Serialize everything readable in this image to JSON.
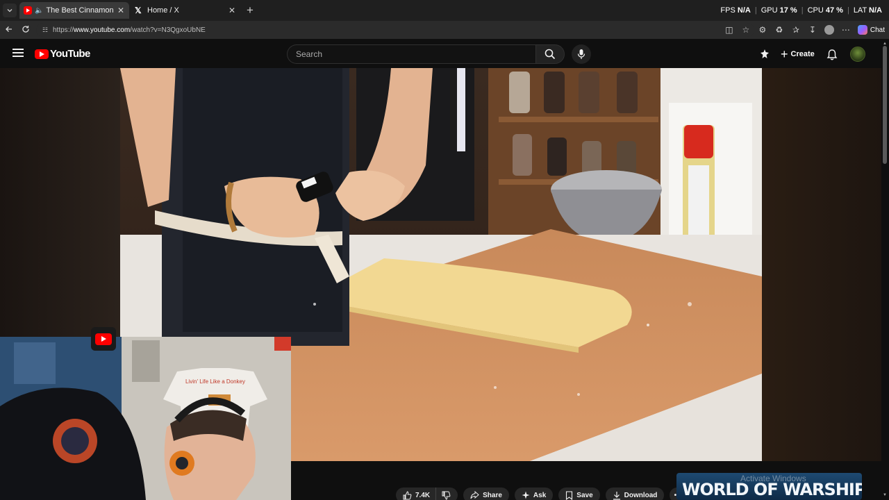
{
  "browser": {
    "tabs": [
      {
        "title": "The Best Cinnamon Buns At H",
        "active": true,
        "audio": true,
        "favicon": "youtube-icon"
      },
      {
        "title": "Home / X",
        "active": false,
        "audio": false,
        "favicon": "x-icon"
      }
    ],
    "stats": {
      "fps_label": "FPS",
      "fps_value": "N/A",
      "gpu_label": "GPU",
      "gpu_value": "17",
      "cpu_label": "CPU",
      "cpu_value": "47",
      "lat_label": "LAT",
      "lat_value": "N/A",
      "percent": "%"
    },
    "url": {
      "scheme": "https://",
      "host": "www.youtube.com",
      "path": "/watch?v=N3QgxoUbNE"
    },
    "chat_label": "Chat"
  },
  "youtube": {
    "logo_text": "YouTube",
    "search_placeholder": "Search",
    "create_label": "Create"
  },
  "actions": {
    "likes": "7.4K",
    "share": "Share",
    "ask": "Ask",
    "save": "Save",
    "download": "Download"
  },
  "ad": {
    "title": "WORLD OF WARSHIPS"
  },
  "watermark": "Activate Windows",
  "webcam": {
    "shirt_text": "Livin' Life Like a Donkey"
  },
  "colors": {
    "youtube_red": "#ff0000",
    "page_bg": "#0f0f0f",
    "chrome_bg": "#1f1f1f"
  }
}
